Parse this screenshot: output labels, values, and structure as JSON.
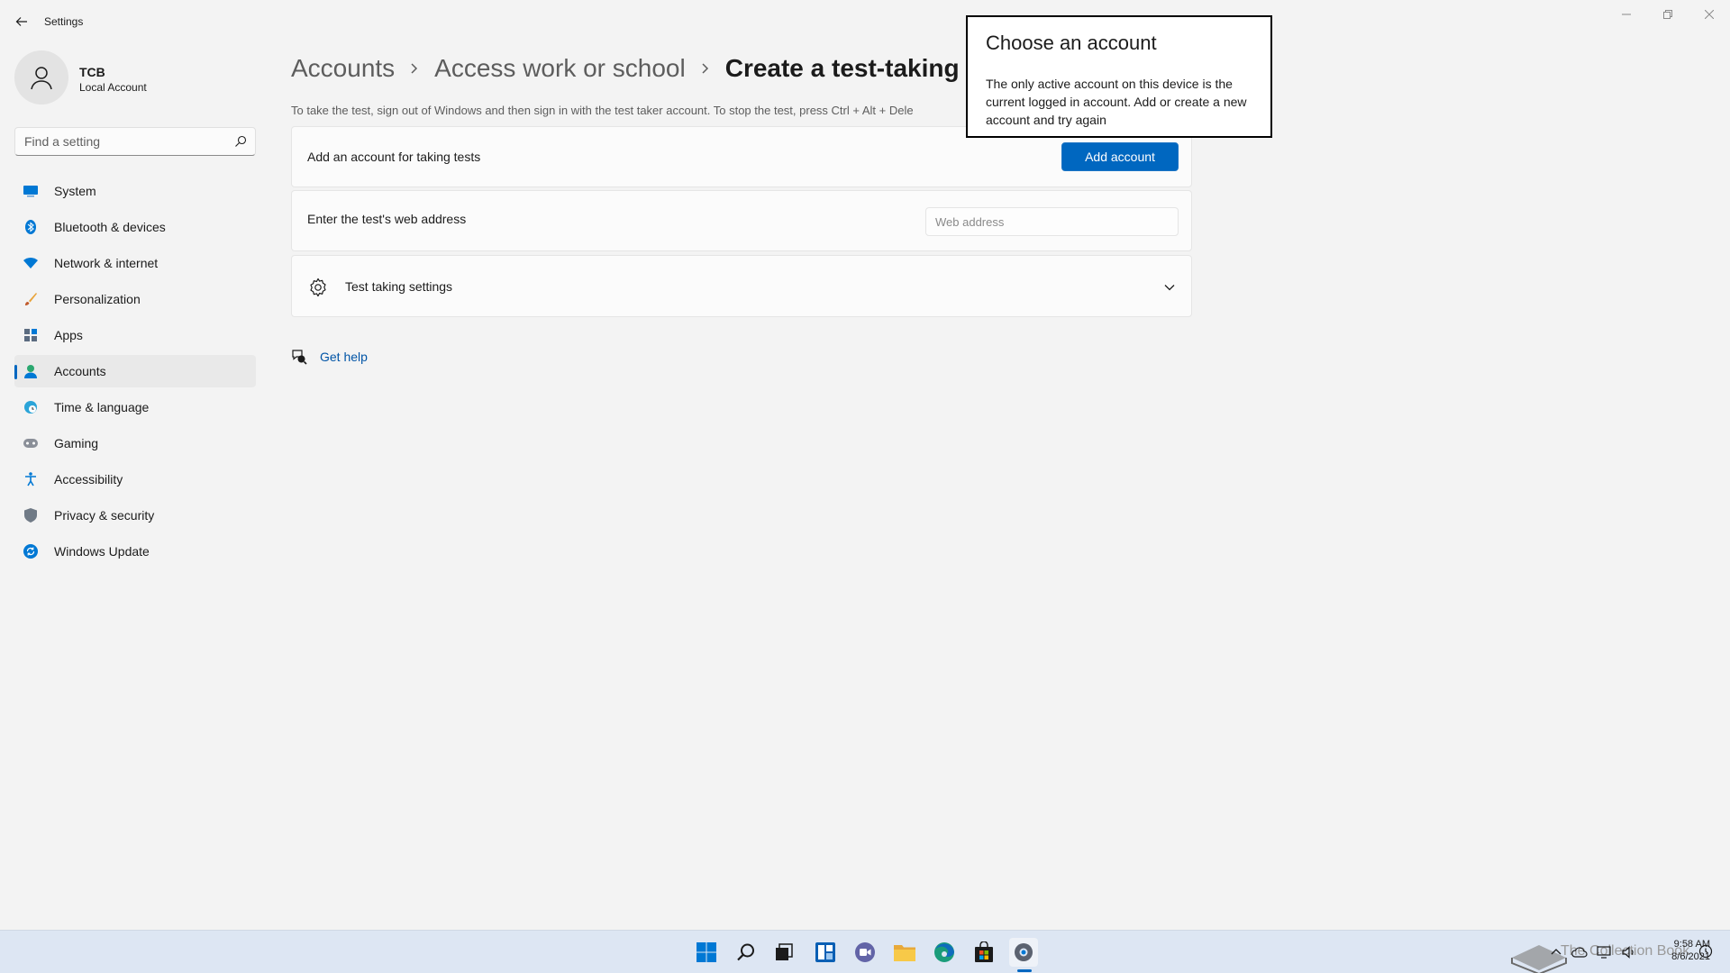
{
  "window": {
    "title": "Settings"
  },
  "profile": {
    "name": "TCB",
    "account_type": "Local Account"
  },
  "search": {
    "placeholder": "Find a setting"
  },
  "sidebar": {
    "items": [
      {
        "label": "System",
        "icon": "system-icon"
      },
      {
        "label": "Bluetooth & devices",
        "icon": "bluetooth-icon"
      },
      {
        "label": "Network & internet",
        "icon": "wifi-icon"
      },
      {
        "label": "Personalization",
        "icon": "brush-icon"
      },
      {
        "label": "Apps",
        "icon": "apps-icon"
      },
      {
        "label": "Accounts",
        "icon": "accounts-icon",
        "active": true
      },
      {
        "label": "Time & language",
        "icon": "globe-clock-icon"
      },
      {
        "label": "Gaming",
        "icon": "gamepad-icon"
      },
      {
        "label": "Accessibility",
        "icon": "accessibility-icon"
      },
      {
        "label": "Privacy & security",
        "icon": "shield-icon"
      },
      {
        "label": "Windows Update",
        "icon": "update-icon"
      }
    ]
  },
  "breadcrumb": {
    "items": [
      "Accounts",
      "Access work or school",
      "Create a test-taking a"
    ]
  },
  "main": {
    "description": "To take the test, sign out of Windows and then sign in with the test taker account. To stop the test, press Ctrl + Alt + Dele",
    "add_account_card": {
      "label": "Add an account for taking tests",
      "button_label": "Add account"
    },
    "web_address_card": {
      "label": "Enter the test's web address",
      "placeholder": "Web address"
    },
    "settings_card": {
      "label": "Test taking settings"
    },
    "help_link": "Get help"
  },
  "flyout": {
    "title": "Choose an account",
    "body": "The only active account on this device is the current logged in account. Add or create a new account and try again"
  },
  "taskbar": {
    "clock_time": "9:58 AM",
    "clock_date": "8/6/2021",
    "watermark": "The Collection Book"
  },
  "colors": {
    "accent": "#0067c0",
    "background": "#f3f3f3",
    "card": "#fbfbfb",
    "taskbar": "#dde6f3"
  }
}
